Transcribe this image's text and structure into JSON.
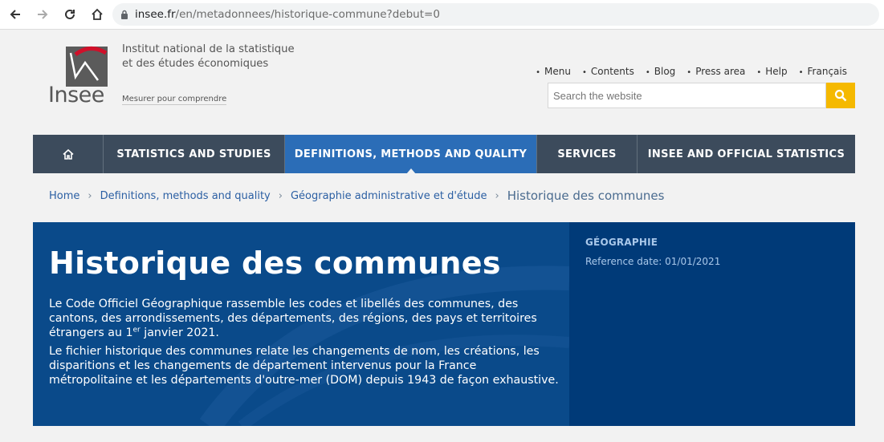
{
  "browser": {
    "url_host": "insee.fr",
    "url_path": "/en/metadonnees/historique-commune?debut=0"
  },
  "header": {
    "logo_word": "Insee",
    "institute_name_line1": "Institut national de la statistique",
    "institute_name_line2": "et des études économiques",
    "tagline": "Mesurer pour comprendre",
    "links": [
      "Menu",
      "Contents",
      "Blog",
      "Press area",
      "Help",
      "Français"
    ],
    "search_placeholder": "Search the website"
  },
  "mainnav": {
    "home_icon": "home-icon",
    "items": [
      "STATISTICS AND STUDIES",
      "DEFINITIONS, METHODS AND QUALITY",
      "SERVICES",
      "INSEE AND OFFICIAL STATISTICS"
    ]
  },
  "breadcrumb": {
    "items": [
      "Home",
      "Definitions, methods and quality",
      "Géographie administrative et d'étude"
    ],
    "current": "Historique des communes"
  },
  "banner": {
    "title": "Historique des communes",
    "para1_part1": "Le Code Officiel Géographique rassemble les codes et libellés des communes, des cantons, des arrondissements, des départements, des régions, des pays et territoires étrangers au 1",
    "para1_sup": "er",
    "para1_part2": " janvier 2021.",
    "para2": "Le fichier historique des communes relate les changements de nom, les créations, les disparitions et les changements de département intervenus pour la France métropolitaine et les départements d'outre-mer (DOM) depuis 1943 de façon exhaustive.",
    "theme": "GÉOGRAPHIE",
    "reference_date": "Reference date: 01/01/2021"
  },
  "colors": {
    "nav_bg": "#3c4b5c",
    "nav_active": "#2b6db7",
    "banner_bg": "#0a4a8a",
    "banner_side": "#003a78",
    "search_button": "#f5b900"
  }
}
